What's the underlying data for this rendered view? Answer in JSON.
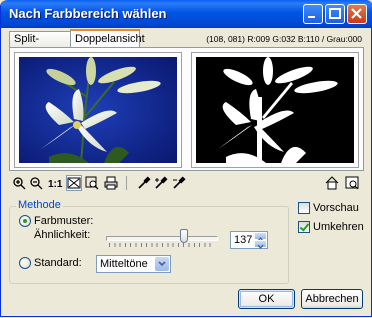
{
  "window": {
    "title": "Nach Farbbereich wählen"
  },
  "tabs": [
    {
      "label": "Split-Screen",
      "active": false
    },
    {
      "label": "Doppelansicht",
      "active": true
    }
  ],
  "readout": "(108, 081) R:009 G:032 B:110 / Grau:000",
  "toolbar_left": [
    "zoom-in-icon",
    "zoom-out-icon",
    "actual-size-icon",
    "fit-window-icon",
    "zoom-box-icon",
    "print-icon"
  ],
  "toolbar_droppers": [
    "eyedropper-icon",
    "eyedropper-add-icon",
    "eyedropper-subtract-icon"
  ],
  "method": {
    "legend": "Methode",
    "color_sample_label": "Farbmuster:",
    "similarity_label": "Ähnlichkeit:",
    "similarity_value": "137",
    "similarity_slider_fraction": 0.7,
    "standard_label": "Standard:",
    "standard_value": "Mitteltöne",
    "selected": "color_sample"
  },
  "options": {
    "preview_label": "Vorschau",
    "preview_checked": false,
    "invert_label": "Umkehren",
    "invert_checked": true
  },
  "buttons": {
    "ok": "OK",
    "cancel": "Abbrechen"
  },
  "colors": {
    "accent": "#0054e3",
    "tab_highlight": "#e68b2c",
    "preview_bg": "#1a2fa0"
  }
}
